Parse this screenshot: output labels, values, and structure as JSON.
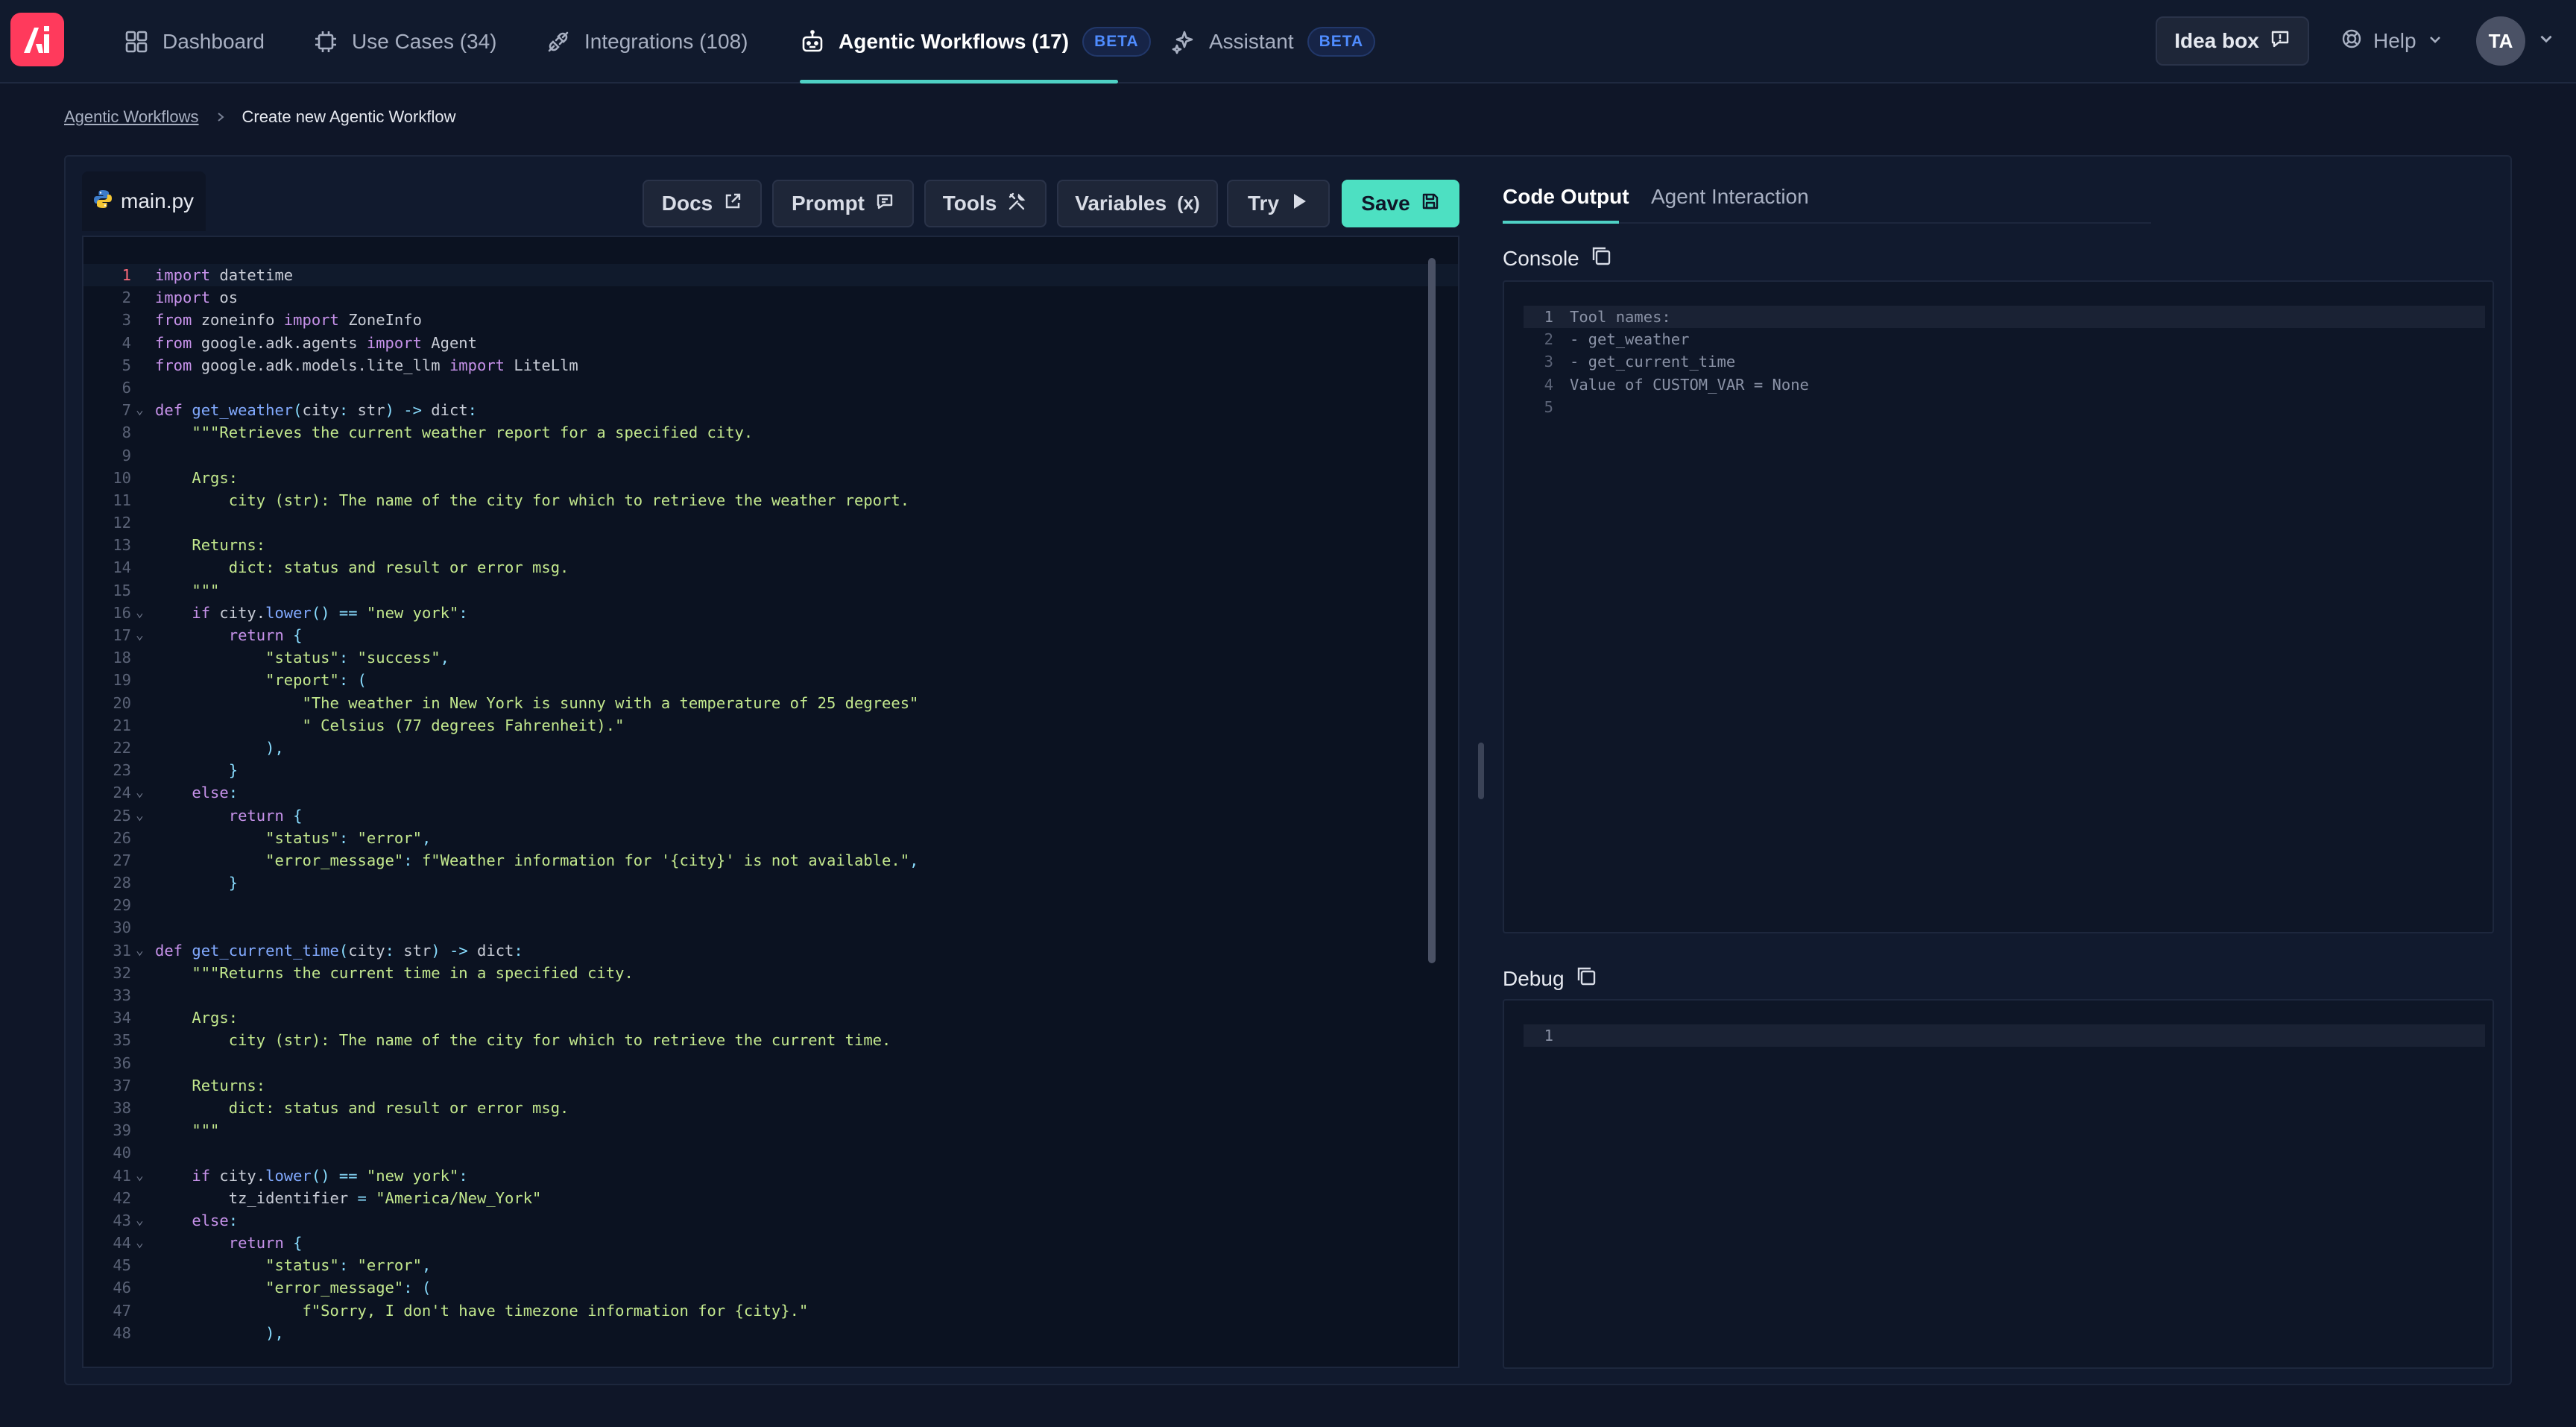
{
  "nav": {
    "tabs": [
      {
        "label": "Dashboard",
        "icon": "dashboard-grid-icon"
      },
      {
        "label": "Use Cases (34)",
        "icon": "chip-icon"
      },
      {
        "label": "Integrations (108)",
        "icon": "plug-icon"
      },
      {
        "label": "Agentic Workflows (17)",
        "icon": "robot-icon",
        "badge": "BETA",
        "active": true
      },
      {
        "label": "Assistant",
        "icon": "sparkle-icon",
        "badge": "BETA"
      }
    ],
    "idea_box": "Idea box",
    "help": "Help",
    "avatar": "TA",
    "accent": "#4fd1c5",
    "logo_color": "#ff3a5c"
  },
  "breadcrumb": {
    "parent": "Agentic Workflows",
    "current": "Create new Agentic Workflow"
  },
  "editor": {
    "file_tab": "main.py",
    "toolbar": {
      "docs": "Docs",
      "prompt": "Prompt",
      "tools": "Tools",
      "variables": "Variables",
      "variables_icon": "(x)",
      "try": "Try",
      "save": "Save"
    },
    "current_line": 1,
    "lines": [
      "import datetime",
      "import os",
      "from zoneinfo import ZoneInfo",
      "from google.adk.agents import Agent",
      "from google.adk.models.lite_llm import LiteLlm",
      "",
      "def get_weather(city: str) -> dict:",
      "    \"\"\"Retrieves the current weather report for a specified city.",
      "",
      "    Args:",
      "        city (str): The name of the city for which to retrieve the weather report.",
      "",
      "    Returns:",
      "        dict: status and result or error msg.",
      "    \"\"\"",
      "    if city.lower() == \"new york\":",
      "        return {",
      "            \"status\": \"success\",",
      "            \"report\": (",
      "                \"The weather in New York is sunny with a temperature of 25 degrees\"",
      "                \" Celsius (77 degrees Fahrenheit).\"",
      "            ),",
      "        }",
      "    else:",
      "        return {",
      "            \"status\": \"error\",",
      "            \"error_message\": f\"Weather information for '{city}' is not available.\",",
      "        }",
      "",
      "",
      "def get_current_time(city: str) -> dict:",
      "    \"\"\"Returns the current time in a specified city.",
      "",
      "    Args:",
      "        city (str): The name of the city for which to retrieve the current time.",
      "",
      "    Returns:",
      "        dict: status and result or error msg.",
      "    \"\"\"",
      "",
      "    if city.lower() == \"new york\":",
      "        tz_identifier = \"America/New_York\"",
      "    else:",
      "        return {",
      "            \"status\": \"error\",",
      "            \"error_message\": (",
      "                f\"Sorry, I don't have timezone information for {city}.\"",
      "            ),"
    ],
    "fold_lines": [
      7,
      16,
      17,
      24,
      25,
      31,
      41,
      43,
      44
    ]
  },
  "output": {
    "tabs": [
      "Code Output",
      "Agent Interaction"
    ],
    "active_tab": "Code Output",
    "console_label": "Console",
    "console_lines": [
      "Tool names:",
      "- get_weather",
      "- get_current_time",
      "Value of CUSTOM_VAR = None",
      ""
    ],
    "debug_label": "Debug",
    "debug_lines": [
      ""
    ]
  }
}
